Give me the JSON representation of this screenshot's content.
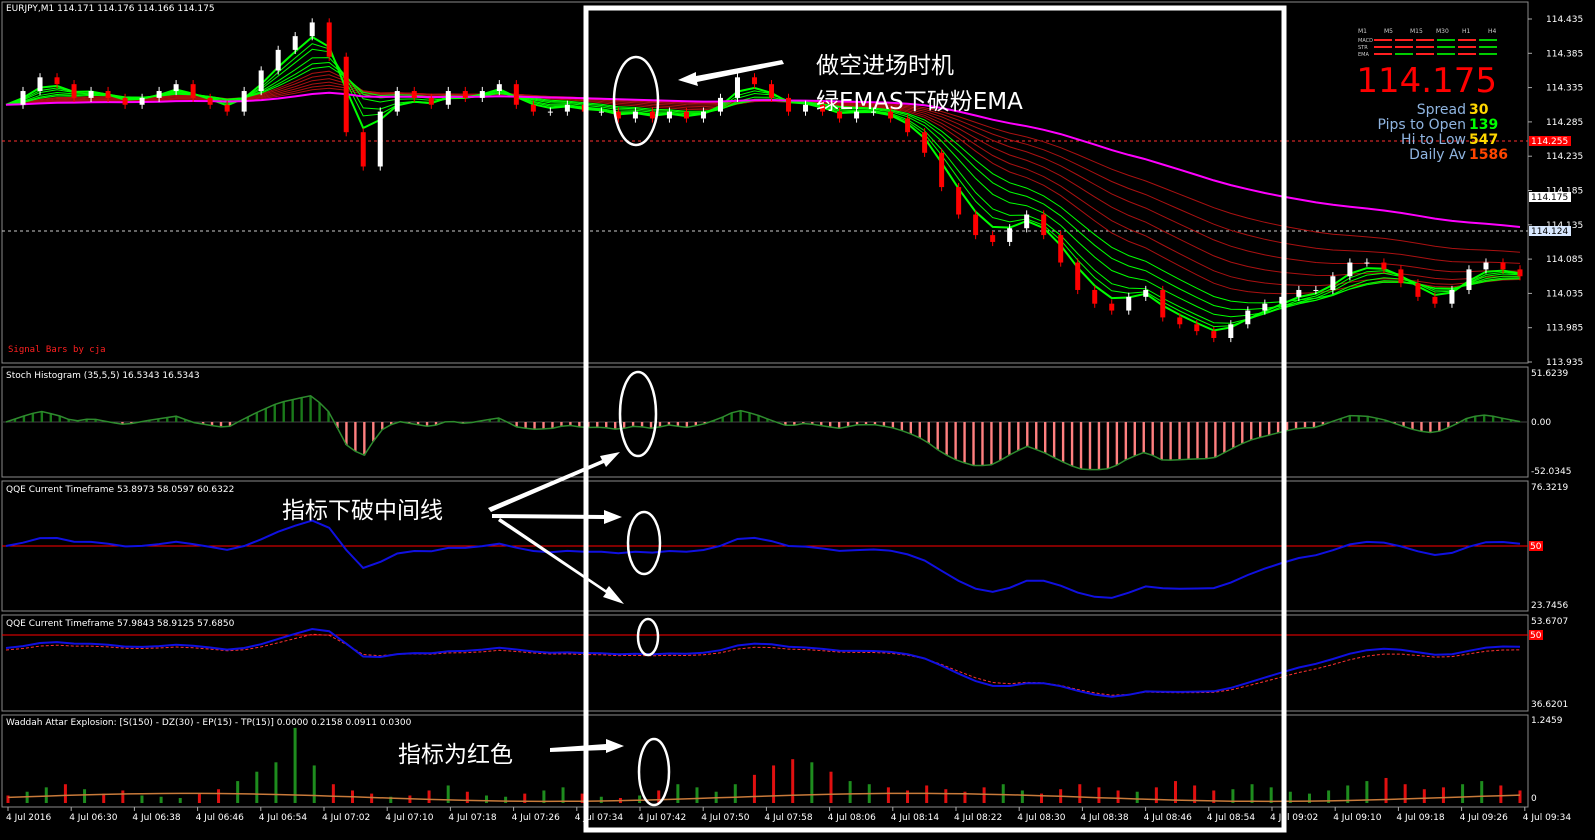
{
  "chart": {
    "symbol_title": "EURJPY,M1  114.171 114.176 114.166 114.175",
    "signature": "Signal Bars by cja",
    "price_axis": [
      "114.435",
      "114.385",
      "114.335",
      "114.285",
      "114.235",
      "114.185",
      "114.135",
      "114.085",
      "114.035",
      "113.985",
      "113.935"
    ],
    "price_tags": {
      "ask_line": "114.255",
      "bid": "114.175",
      "dashed_line": "114.124"
    },
    "colors": {
      "bull_candle": "#ffffff",
      "bear_candle": "#ff0000",
      "fast_ema": "#00ff00",
      "slow_ema": "#aa1111",
      "pink_ema": "#ff00ff",
      "stoch_pos": "#1a7a1a",
      "stoch_neg": "#ff8080",
      "qqe_line": "#1010e0",
      "red_line": "#ff0000",
      "frame": "#ffffff"
    }
  },
  "signal_panel": {
    "columns": [
      "M1",
      "M5",
      "M15",
      "M30",
      "H1",
      "H4"
    ],
    "rows": [
      "MACD",
      "STR",
      "EMA"
    ],
    "big_price": "114.175",
    "stats": [
      {
        "label": "Spread",
        "value": "30",
        "color": "#ffd700"
      },
      {
        "label": "Pips to Open",
        "value": "139",
        "color": "#00ff00"
      },
      {
        "label": "Hi to Low",
        "value": "547",
        "color": "#ffd700"
      },
      {
        "label": "Daily Av",
        "value": "1586",
        "color": "#ff4500"
      }
    ]
  },
  "panels": {
    "stoch": {
      "title": "Stoch Histogram (35,5,5) 16.5343 16.5343",
      "axis": [
        "51.6239",
        "0.00",
        "-52.0345"
      ]
    },
    "qqe1": {
      "title": "QQE Current Timeframe 53.8973 58.0597 60.6322",
      "axis": [
        "76.3219",
        "50",
        "23.7456"
      ]
    },
    "qqe2": {
      "title": "QQE Current Timeframe 57.9843 58.9125 57.6850",
      "axis": [
        "53.6707",
        "50",
        "36.6201"
      ]
    },
    "waddah": {
      "title": "Waddah Attar Explosion: [S(150) - DZ(30) - EP(15) - TP(15)] 0.0000 0.2158 0.0911 0.0300",
      "axis": [
        "1.2459",
        "0"
      ]
    }
  },
  "time_axis": [
    "4 Jul 2016",
    "4 Jul 06:30",
    "4 Jul 06:38",
    "4 Jul 06:46",
    "4 Jul 06:54",
    "4 Jul 07:02",
    "4 Jul 07:10",
    "4 Jul 07:18",
    "4 Jul 07:26",
    "4 Jul 07:34",
    "4 Jul 07:42",
    "4 Jul 07:50",
    "4 Jul 07:58",
    "4 Jul 08:06",
    "4 Jul 08:14",
    "4 Jul 08:22",
    "4 Jul 08:30",
    "4 Jul 08:38",
    "4 Jul 08:46",
    "4 Jul 08:54",
    "4 Jul 09:02",
    "4 Jul 09:10",
    "4 Jul 09:18",
    "4 Jul 09:26",
    "4 Jul 09:34"
  ],
  "annotations": {
    "entry_line1": "做空进场时机",
    "entry_line2": "绿EMAS下破粉EMA",
    "cross_mid": "指标下破中间线",
    "red_bars": "指标为红色"
  },
  "price_series": [
    114.31,
    114.33,
    114.35,
    114.34,
    114.32,
    114.33,
    114.32,
    114.31,
    114.32,
    114.33,
    114.34,
    114.32,
    114.31,
    114.3,
    114.33,
    114.36,
    114.39,
    114.41,
    114.43,
    114.38,
    114.27,
    114.22,
    114.3,
    114.33,
    114.32,
    114.31,
    114.33,
    114.32,
    114.33,
    114.34,
    114.31,
    114.3,
    114.3,
    114.31,
    114.3,
    114.3,
    114.29,
    114.3,
    114.29,
    114.3,
    114.29,
    114.3,
    114.32,
    114.35,
    114.34,
    114.32,
    114.3,
    114.31,
    114.3,
    114.29,
    114.3,
    114.3,
    114.29,
    114.27,
    114.24,
    114.19,
    114.15,
    114.12,
    114.11,
    114.13,
    114.15,
    114.12,
    114.08,
    114.04,
    114.02,
    114.01,
    114.03,
    114.04,
    114.0,
    113.99,
    113.98,
    113.97,
    113.99,
    114.01,
    114.02,
    114.03,
    114.04,
    114.04,
    114.06,
    114.08,
    114.08,
    114.07,
    114.05,
    114.03,
    114.02,
    114.04,
    114.07,
    114.08,
    114.07,
    114.06
  ],
  "waddah_bars": [
    0.12,
    0.18,
    0.25,
    0.3,
    0.22,
    0.15,
    0.2,
    0.12,
    0.1,
    0.08,
    0.15,
    0.22,
    0.35,
    0.5,
    0.65,
    1.2,
    0.6,
    0.3,
    0.2,
    0.15,
    0.1,
    0.12,
    0.2,
    0.28,
    0.18,
    0.12,
    0.1,
    0.15,
    0.2,
    0.25,
    0.15,
    0.1,
    0.08,
    0.12,
    0.2,
    0.3,
    0.25,
    0.18,
    0.3,
    0.45,
    0.6,
    0.7,
    0.65,
    0.5,
    0.35,
    0.3,
    0.25,
    0.2,
    0.28,
    0.22,
    0.18,
    0.25,
    0.3,
    0.2,
    0.15,
    0.22,
    0.3,
    0.25,
    0.2,
    0.18,
    0.25,
    0.35,
    0.28,
    0.2,
    0.22,
    0.3,
    0.25,
    0.18,
    0.15,
    0.2,
    0.28,
    0.35,
    0.4,
    0.3,
    0.22,
    0.25,
    0.3,
    0.35,
    0.28,
    0.2
  ]
}
